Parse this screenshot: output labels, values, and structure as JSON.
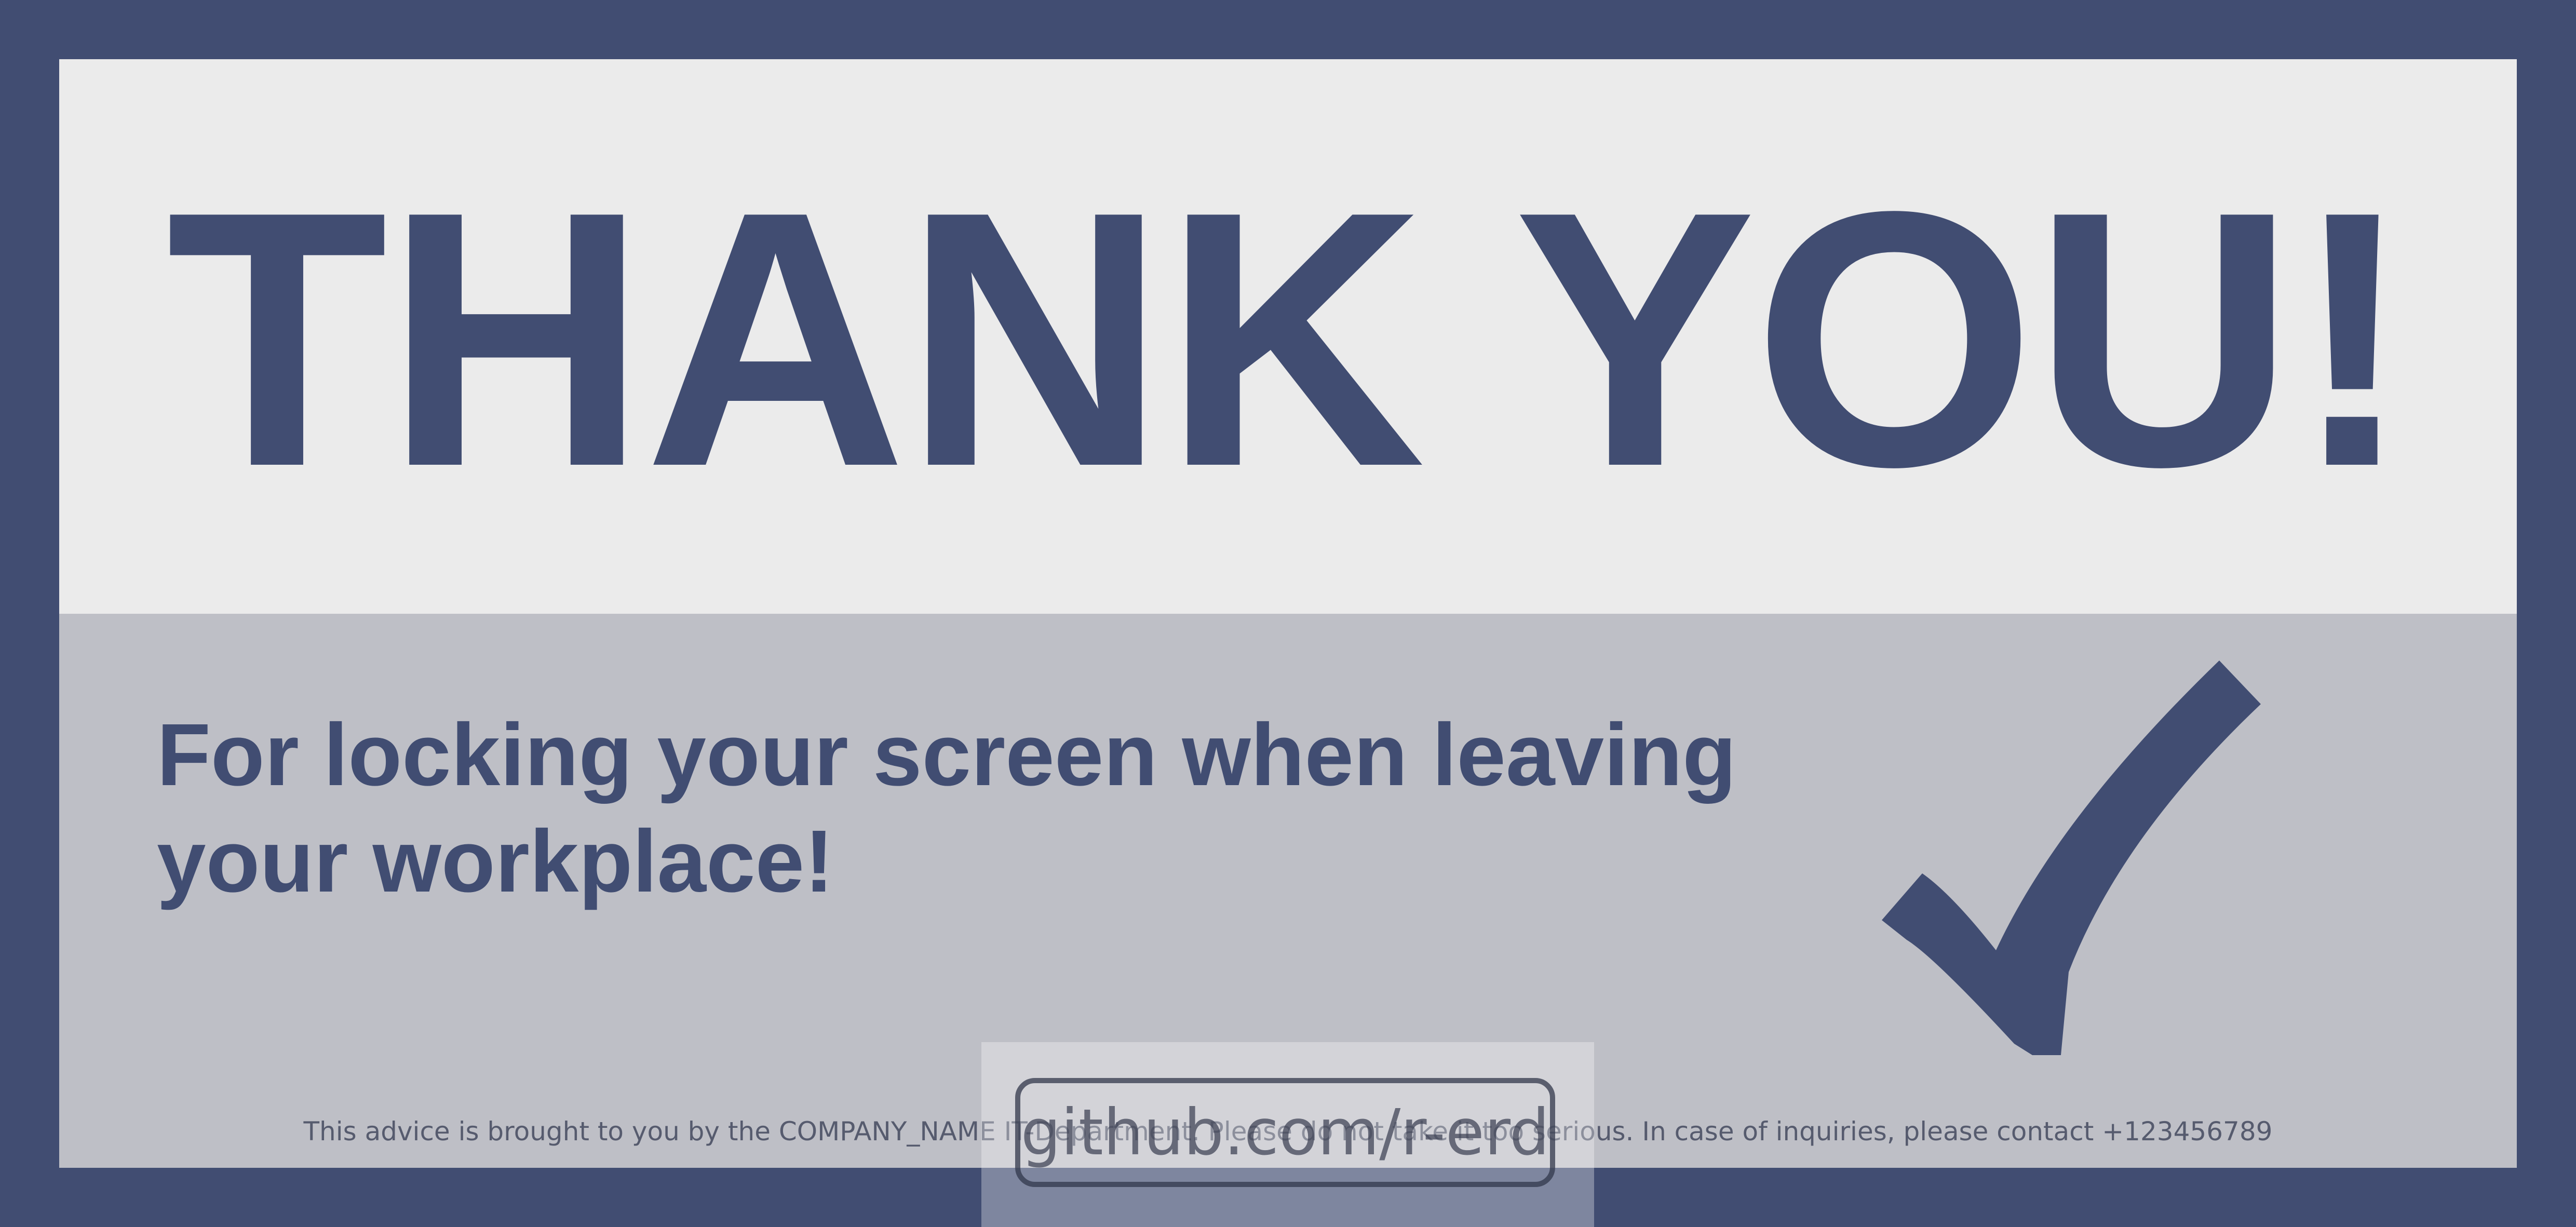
{
  "poster": {
    "headline": "THANK YOU!",
    "subline": "For locking your screen when leaving your workplace!",
    "footer_note": "This advice is brought to you by the COMPANY_NAME IT-Department. Please do not take it too serious. In case of inquiries, please contact +123456789",
    "checkmark_icon": "checkmark-icon"
  },
  "watermark": {
    "text": "github.com/r-erd"
  },
  "colors": {
    "navy": "#414d72",
    "top_panel": "#ebebeb",
    "bottom_panel": "#bebfc6",
    "footer_text": "#565b6e"
  }
}
